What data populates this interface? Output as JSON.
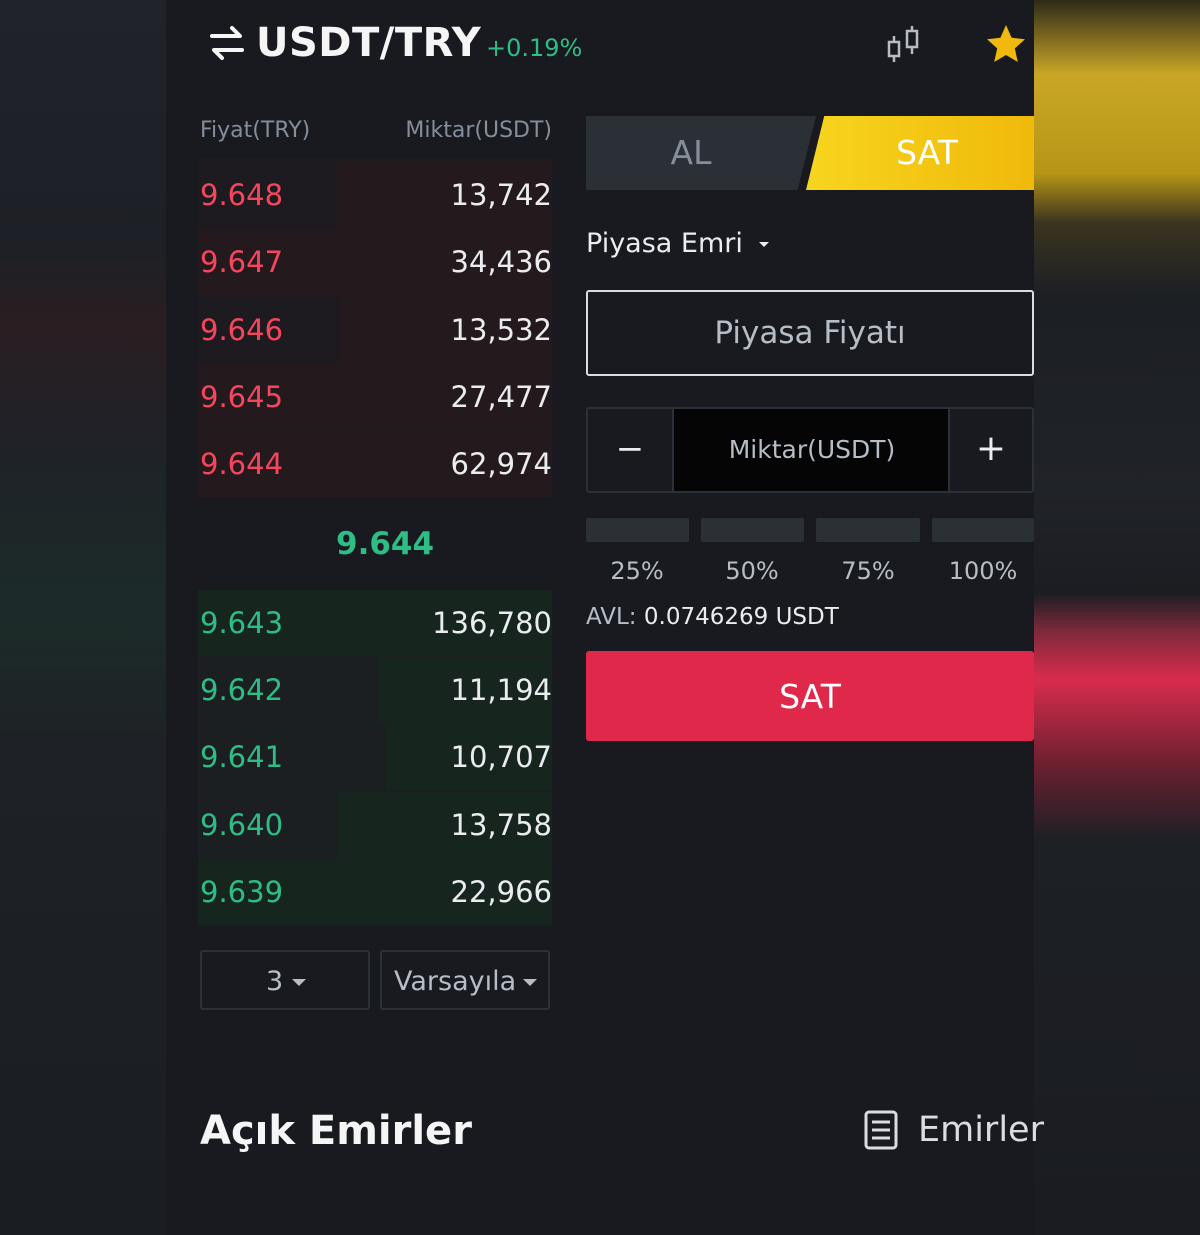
{
  "header": {
    "pair": "USDT/TRY",
    "change": "+0.19%",
    "swap_icon": "swap-arrows-icon",
    "chart_icon": "candlestick-icon",
    "favorite_icon": "star-icon"
  },
  "orderbook": {
    "price_header": "Fiyat(TRY)",
    "qty_header": "Miktar(USDT)",
    "asks": [
      {
        "price": "9.648",
        "qty": "13,742"
      },
      {
        "price": "9.647",
        "qty": "34,436"
      },
      {
        "price": "9.646",
        "qty": "13,532"
      },
      {
        "price": "9.645",
        "qty": "27,477"
      },
      {
        "price": "9.644",
        "qty": "62,974"
      }
    ],
    "last_price": "9.644",
    "bids": [
      {
        "price": "9.643",
        "qty": "136,780"
      },
      {
        "price": "9.642",
        "qty": "11,194"
      },
      {
        "price": "9.641",
        "qty": "10,707"
      },
      {
        "price": "9.640",
        "qty": "13,758"
      },
      {
        "price": "9.639",
        "qty": "22,966"
      }
    ],
    "depth_select": "3",
    "mode_select": "Varsayıla"
  },
  "form": {
    "tab_buy": "AL",
    "tab_sell": "SAT",
    "order_type": "Piyasa Emri",
    "price_placeholder": "Piyasa Fiyatı",
    "qty_placeholder": "Miktar(USDT)",
    "minus": "−",
    "plus": "+",
    "percents": [
      "25%",
      "50%",
      "75%",
      "100%"
    ],
    "avl_label": "AVL:",
    "avl_value": "0.0746269 USDT",
    "submit": "SAT"
  },
  "footer": {
    "open_orders": "Açık Emirler",
    "orders_link": "Emirler"
  },
  "colors": {
    "ask": "#f6465d",
    "bid": "#2ebd85",
    "sell_button": "#e0294a",
    "sell_tab": "#f0b90b"
  }
}
